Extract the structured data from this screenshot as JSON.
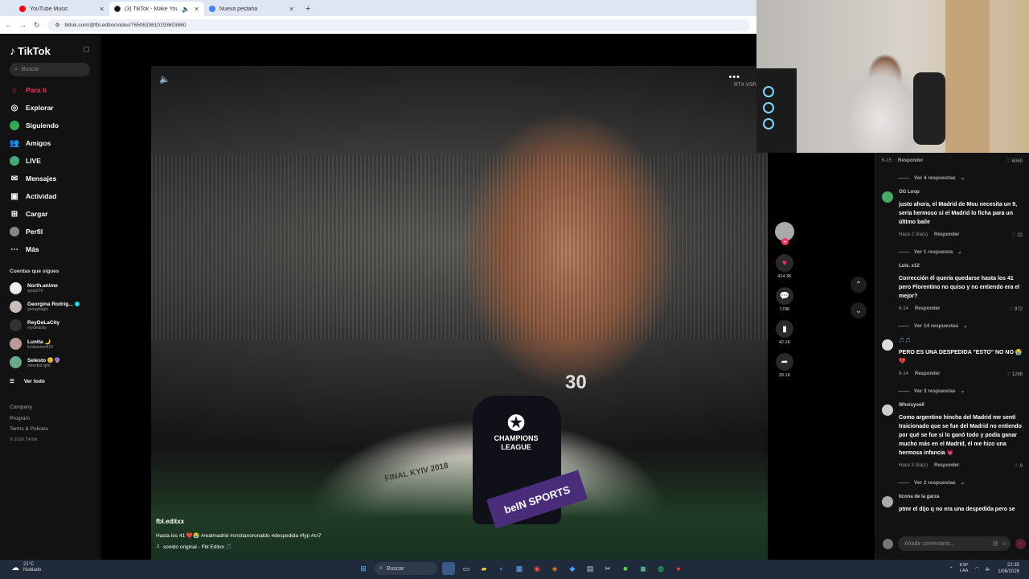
{
  "browser": {
    "tabs": [
      {
        "title": "YouTube Music",
        "color": "#ff0000",
        "active": false
      },
      {
        "title": "(3) TikTok - Make Your Day",
        "color": "#111111",
        "active": true
      },
      {
        "title": "Nueva pestaña",
        "color": "#4285f4",
        "active": false
      }
    ],
    "url": "tiktok.com/@fbl.editxx/video/7650633610193603860"
  },
  "sidebar": {
    "brand": "TikTok",
    "search_placeholder": "Buscar",
    "nav": [
      {
        "label": "Para ti",
        "icon": "home-icon"
      },
      {
        "label": "Explorar",
        "icon": "compass-icon"
      },
      {
        "label": "Siguiendo",
        "icon": "following-icon"
      },
      {
        "label": "Amigos",
        "icon": "friends-icon"
      },
      {
        "label": "LIVE",
        "icon": "live-icon"
      },
      {
        "label": "Mensajes",
        "icon": "messages-icon"
      },
      {
        "label": "Actividad",
        "icon": "activity-icon"
      },
      {
        "label": "Cargar",
        "icon": "upload-icon"
      },
      {
        "label": "Perfil",
        "icon": "profile-icon"
      },
      {
        "label": "Más",
        "icon": "more-icon"
      }
    ],
    "following_title": "Cuentas que sigues",
    "following": [
      {
        "name": "North.anime",
        "handle": "spop579"
      },
      {
        "name": "Georgina Rodríg...",
        "handle": "georginagio"
      },
      {
        "name": "ReyDeLaCity",
        "handle": "reydelacity"
      },
      {
        "name": "Lunita 🌙",
        "handle": "lunitaweed420"
      },
      {
        "name": "Selesto 😊🔮",
        "handle": "selestial.light"
      }
    ],
    "see_all": "Ver todo",
    "footer": [
      "Company",
      "Program",
      "Terms & Policies"
    ],
    "copyright": "© 2026 TikTok"
  },
  "video": {
    "author": "fbl.editxx",
    "description": "Hasta los 41 ❤️😭 #realmadrid #cristianoronaldo #despedida #fyp #cr7",
    "music": "sonido original - Fbl Editxx 🎵",
    "overlay_tag": "RTX VSR",
    "scene_text_final": "FINAL KYIV 2018",
    "scene_text_mic": "CHAMPIONS LEAGUE",
    "scene_text_bein": "beIN SPORTS",
    "scene_number": "30",
    "progress": 0.14
  },
  "actions": {
    "likes": "414.3K",
    "comments": "1788",
    "saves": "42.1K",
    "shares": "39.1K"
  },
  "comments": {
    "reply_label": "Responder",
    "top_meta": {
      "date": "6-15",
      "likes": "6069"
    },
    "top_view_more": "Ver 4 respuestas",
    "items": [
      {
        "user": "OG Loop",
        "text": "justo ahora, el Madrid de Mou necesita un 9, sería hermoso si el Madrid lo ficha para un último baile",
        "date": "Hace 2 día(s)",
        "likes": "22",
        "replies": "Ver 1 respuesta"
      },
      {
        "user": "Luis. x12",
        "text": "Corrección él quería quedarse hasta los 41 pero Florentino no quiso y no entiendo era el mejor?",
        "date": "6-14",
        "likes": "972",
        "replies": "Ver 14 respuestas"
      },
      {
        "user": "🎵🎵",
        "text": "PERO ES UNA DESPEDIDA \"ESTO\" NO NO 😭💔",
        "date": "6-14",
        "likes": "1288",
        "replies": "Ver 3 respuestas"
      },
      {
        "user": "Whoisyoell",
        "text": "Como argentino hincha del Madrid me sentí traicionado que se fue del Madrid no entiendo por qué se fue si lo ganó todo y podía ganar mucho más en el Madrid, él me hizo una hermosa infancia 💗",
        "date": "Hace 3 día(s)",
        "likes": "9",
        "replies": "Ver 2 respuestas"
      },
      {
        "user": "ticona de la garza",
        "text": "ptmr el dijo q no era una despedida pero se",
        "date": "",
        "likes": "",
        "replies": ""
      }
    ],
    "input_placeholder": "Añadir comentario..."
  },
  "taskbar": {
    "weather_temp": "21°C",
    "weather_desc": "Nublado",
    "search": "Buscar",
    "lang_top": "ESP",
    "lang_bottom": "LAA",
    "time": "22:35",
    "date": "1/06/2026"
  }
}
